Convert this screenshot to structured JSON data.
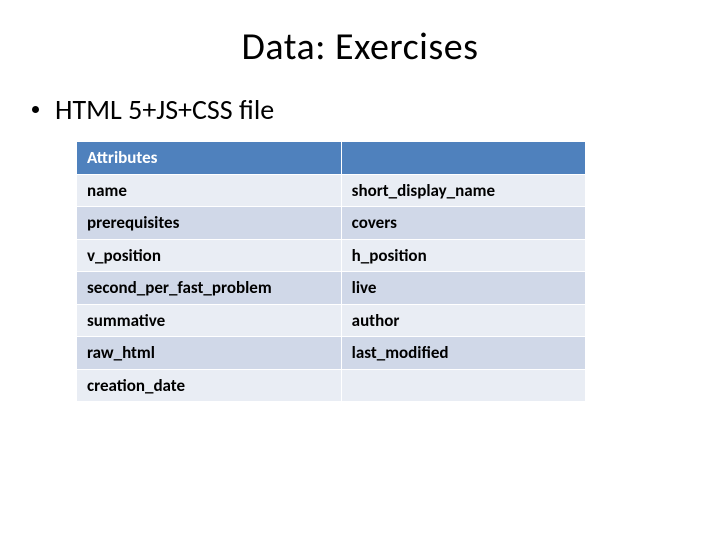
{
  "title": "Data: Exercises",
  "bullet": "HTML 5+JS+CSS file",
  "table": {
    "header_left": "Attributes",
    "header_right": "",
    "rows": [
      {
        "left": "name",
        "right": "short_display_name"
      },
      {
        "left": "prerequisites",
        "right": "covers"
      },
      {
        "left": "v_position",
        "right": "h_position"
      },
      {
        "left": "second_per_fast_problem",
        "right": "live"
      },
      {
        "left": "summative",
        "right": "author"
      },
      {
        "left": "raw_html",
        "right": "last_modified"
      },
      {
        "left": "creation_date",
        "right": ""
      }
    ]
  },
  "colors": {
    "header_bg": "#4f81bd",
    "row_odd": "#e9edf4",
    "row_even": "#d0d8e8"
  }
}
